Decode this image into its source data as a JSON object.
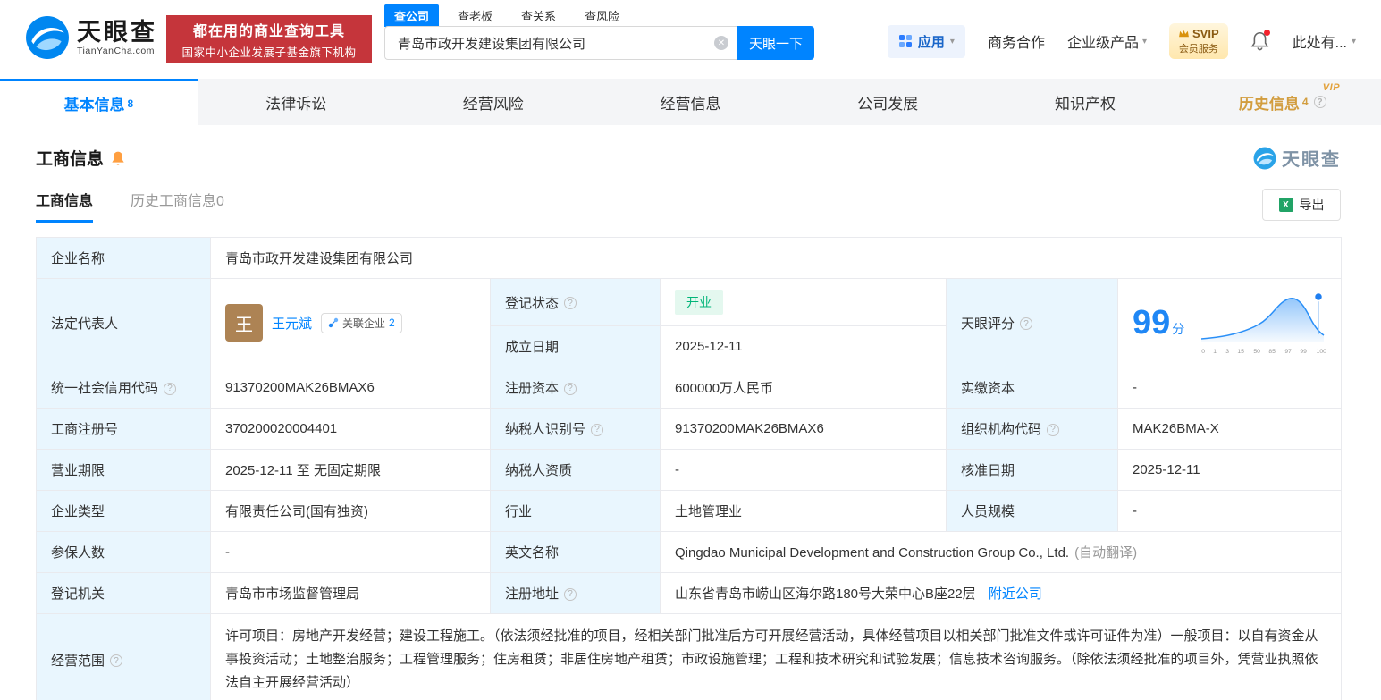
{
  "icons": {
    "caret": "▾",
    "clear": "✕",
    "help": "?"
  },
  "colors": {
    "brand_blue": "#0084ff",
    "banner_red": "#c5353b",
    "label_cell_bg": "#e9f6fe",
    "status_green": "#00b578",
    "history_gold": "#d29d3f"
  },
  "header": {
    "logo": {
      "cn": "天眼查",
      "en": "TianYanCha.com"
    },
    "banner": {
      "line1": "都在用的商业查询工具",
      "line2": "国家中小企业发展子基金旗下机构"
    },
    "search": {
      "tabs": [
        "查公司",
        "查老板",
        "查关系",
        "查风险"
      ],
      "value": "青岛市政开发建设集团有限公司",
      "button": "天眼一下"
    },
    "right": {
      "apps": "应用",
      "coop": "商务合作",
      "enterprise": "企业级产品",
      "vip_top": "SVIP",
      "vip_bottom": "会员服务",
      "user": "此处有..."
    }
  },
  "tabs": [
    {
      "label": "基本信息",
      "count": "8"
    },
    {
      "label": "法律诉讼"
    },
    {
      "label": "经营风险"
    },
    {
      "label": "经营信息"
    },
    {
      "label": "公司发展"
    },
    {
      "label": "知识产权"
    },
    {
      "label": "历史信息",
      "count": "4",
      "vip": "VIP"
    }
  ],
  "section": {
    "title": "工商信息",
    "watermark": "天眼查",
    "subtabs": [
      {
        "label": "工商信息"
      },
      {
        "label": "历史工商信息",
        "count": "0"
      }
    ],
    "export_label": "导出"
  },
  "table": {
    "company_name_label": "企业名称",
    "company_name_value": "青岛市政开发建设集团有限公司",
    "legal_rep_label": "法定代表人",
    "legal_rep_avatar": "王",
    "legal_rep_name": "王元斌",
    "related_badge_label": "关联企业",
    "related_badge_count": "2",
    "reg_status_label": "登记状态",
    "reg_status_value": "开业",
    "score_label": "天眼评分",
    "score_value": "99",
    "score_unit": "分",
    "score_axis": [
      "0",
      "1",
      "3",
      "15",
      "50",
      "85",
      "97",
      "99",
      "100"
    ],
    "establish_label": "成立日期",
    "establish_value": "2025-12-11",
    "credit_code_label": "统一社会信用代码",
    "credit_code_value": "91370200MAK26BMAX6",
    "reg_capital_label": "注册资本",
    "reg_capital_value": "600000万人民币",
    "paid_capital_label": "实缴资本",
    "paid_capital_value": "-",
    "reg_number_label": "工商注册号",
    "reg_number_value": "370200020004401",
    "taxpayer_id_label": "纳税人识别号",
    "taxpayer_id_value": "91370200MAK26BMAX6",
    "org_code_label": "组织机构代码",
    "org_code_value": "MAK26BMA-X",
    "business_term_label": "营业期限",
    "business_term_value": "2025-12-11 至 无固定期限",
    "taxpayer_quality_label": "纳税人资质",
    "taxpayer_quality_value": "-",
    "approval_date_label": "核准日期",
    "approval_date_value": "2025-12-11",
    "company_type_label": "企业类型",
    "company_type_value": "有限责任公司(国有独资)",
    "industry_label": "行业",
    "industry_value": "土地管理业",
    "staff_size_label": "人员规模",
    "staff_size_value": "-",
    "insured_label": "参保人数",
    "insured_value": "-",
    "english_name_label": "英文名称",
    "english_name_value": "Qingdao Municipal Development and Construction Group Co., Ltd.",
    "english_name_note": "(自动翻译)",
    "reg_authority_label": "登记机关",
    "reg_authority_value": "青岛市市场监督管理局",
    "address_label": "注册地址",
    "address_value": "山东省青岛市崂山区海尔路180号大荣中心B座22层",
    "address_link": "附近公司",
    "business_scope_label": "经营范围",
    "business_scope_value": "许可项目：房地产开发经营；建设工程施工。（依法须经批准的项目，经相关部门批准后方可开展经营活动，具体经营项目以相关部门批准文件或许可证件为准）一般项目：以自有资金从事投资活动；土地整治服务；工程管理服务；住房租赁；非居住房地产租赁；市政设施管理；工程和技术研究和试验发展；信息技术咨询服务。（除依法须经批准的项目外，凭营业执照依法自主开展经营活动）"
  }
}
